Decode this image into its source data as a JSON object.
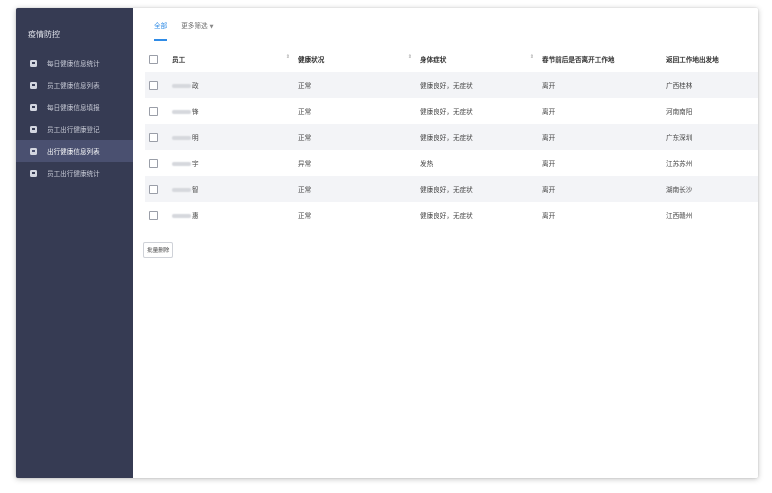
{
  "sidebar": {
    "title": "疫情防控",
    "items": [
      {
        "label": "每日健康信息统计"
      },
      {
        "label": "员工健康信息列表"
      },
      {
        "label": "每日健康信息填报"
      },
      {
        "label": "员工出行健康登记"
      },
      {
        "label": "出行健康信息列表"
      },
      {
        "label": "员工出行健康统计"
      }
    ]
  },
  "tabs": {
    "all": "全部",
    "more_filters": "更多筛选"
  },
  "table": {
    "headers": [
      "员工",
      "健康状况",
      "身体症状",
      "春节前后是否离开工作地",
      "返回工作地出发地"
    ],
    "rows": [
      {
        "name": "政",
        "health": "正常",
        "symptom": "健康良好，无症状",
        "left": "离开",
        "origin": "广西桂林"
      },
      {
        "name": "锋",
        "health": "正常",
        "symptom": "健康良好，无症状",
        "left": "离开",
        "origin": "河南南阳"
      },
      {
        "name": "明",
        "health": "正常",
        "symptom": "健康良好，无症状",
        "left": "离开",
        "origin": "广东深圳"
      },
      {
        "name": "宇",
        "health": "异常",
        "symptom": "发热",
        "left": "离开",
        "origin": "江苏苏州"
      },
      {
        "name": "智",
        "health": "正常",
        "symptom": "健康良好，无症状",
        "left": "离开",
        "origin": "湖南长沙"
      },
      {
        "name": "惠",
        "health": "正常",
        "symptom": "健康良好，无症状",
        "left": "离开",
        "origin": "江西赣州"
      }
    ]
  },
  "actions": {
    "batch_delete": "批量删除"
  },
  "colors": {
    "sidebar_bg": "#363b53",
    "active_bg": "#4a5070",
    "accent": "#2f8be6"
  }
}
